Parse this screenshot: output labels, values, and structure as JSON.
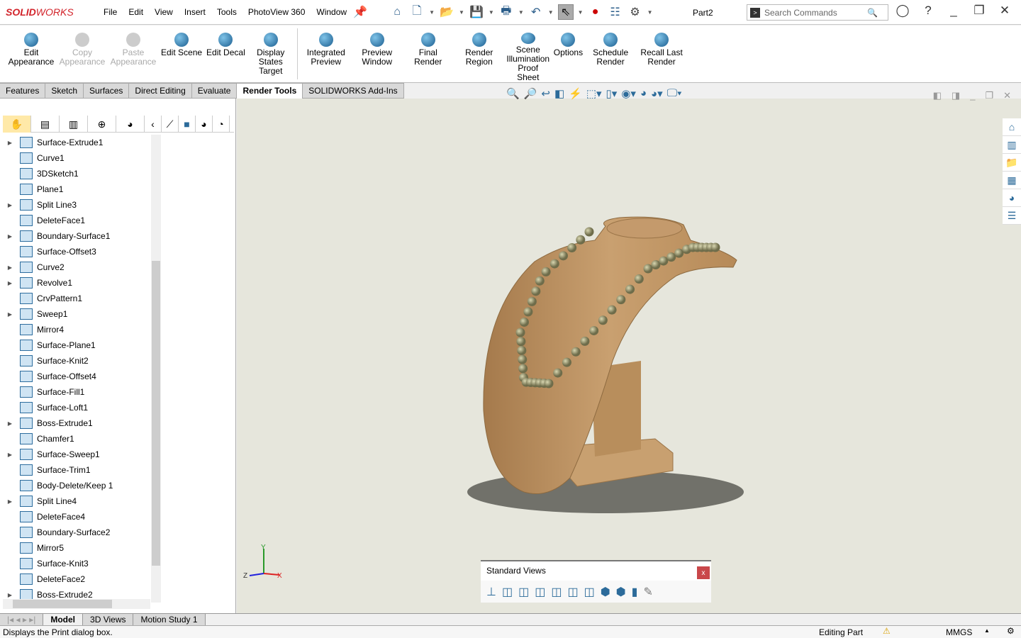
{
  "app": {
    "brand_bold": "SOLID",
    "brand_light": "WORKS",
    "document_title": "Part2"
  },
  "menu": [
    "File",
    "Edit",
    "View",
    "Insert",
    "Tools",
    "PhotoView 360",
    "Window"
  ],
  "search": {
    "placeholder": "Search Commands"
  },
  "ribbon": [
    {
      "label": "Edit Appearance",
      "enabled": true
    },
    {
      "label": "Copy Appearance",
      "enabled": false
    },
    {
      "label": "Paste Appearance",
      "enabled": false
    },
    {
      "label": "Edit Scene",
      "enabled": true
    },
    {
      "label": "Edit Decal",
      "enabled": true
    },
    {
      "label": "Display States Target",
      "enabled": true
    },
    {
      "label": "Integrated Preview",
      "enabled": true
    },
    {
      "label": "Preview Window",
      "enabled": true
    },
    {
      "label": "Final Render",
      "enabled": true
    },
    {
      "label": "Render Region",
      "enabled": true
    },
    {
      "label": "Scene Illumination Proof Sheet",
      "enabled": true
    },
    {
      "label": "Options",
      "enabled": true
    },
    {
      "label": "Schedule Render",
      "enabled": true
    },
    {
      "label": "Recall Last Render",
      "enabled": true
    }
  ],
  "command_tabs": [
    {
      "label": "Features"
    },
    {
      "label": "Sketch"
    },
    {
      "label": "Surfaces"
    },
    {
      "label": "Direct Editing"
    },
    {
      "label": "Evaluate"
    },
    {
      "label": "Render Tools",
      "active": true
    },
    {
      "label": "SOLIDWORKS Add-Ins"
    }
  ],
  "feature_tree": [
    {
      "label": "Surface-Extrude1",
      "expandable": true
    },
    {
      "label": "Curve1"
    },
    {
      "label": "3DSketch1"
    },
    {
      "label": "Plane1"
    },
    {
      "label": "Split Line3",
      "expandable": true
    },
    {
      "label": "DeleteFace1"
    },
    {
      "label": "Boundary-Surface1",
      "expandable": true
    },
    {
      "label": "Surface-Offset3"
    },
    {
      "label": "Curve2",
      "expandable": true
    },
    {
      "label": "Revolve1",
      "expandable": true
    },
    {
      "label": "CrvPattern1"
    },
    {
      "label": "Sweep1",
      "expandable": true
    },
    {
      "label": "Mirror4"
    },
    {
      "label": "Surface-Plane1"
    },
    {
      "label": "Surface-Knit2"
    },
    {
      "label": "Surface-Offset4"
    },
    {
      "label": "Surface-Fill1"
    },
    {
      "label": "Surface-Loft1"
    },
    {
      "label": "Boss-Extrude1",
      "expandable": true
    },
    {
      "label": "Chamfer1"
    },
    {
      "label": "Surface-Sweep1",
      "expandable": true
    },
    {
      "label": "Surface-Trim1"
    },
    {
      "label": "Body-Delete/Keep 1"
    },
    {
      "label": "Split Line4",
      "expandable": true
    },
    {
      "label": "DeleteFace4"
    },
    {
      "label": "Boundary-Surface2"
    },
    {
      "label": "Mirror5"
    },
    {
      "label": "Surface-Knit3"
    },
    {
      "label": "DeleteFace2"
    },
    {
      "label": "Boss-Extrude2",
      "expandable": true
    }
  ],
  "standard_views": {
    "title": "Standard Views",
    "close": "x"
  },
  "triad": {
    "x": "X",
    "y": "Y",
    "z": "Z"
  },
  "bottom_tabs": [
    {
      "label": "Model",
      "active": true
    },
    {
      "label": "3D Views"
    },
    {
      "label": "Motion Study 1"
    }
  ],
  "status": {
    "message": "Displays the Print dialog box.",
    "mode": "Editing Part",
    "units": "MMGS"
  },
  "colors": {
    "brand": "#d2232a",
    "wood": "#c49a6c",
    "viewport_bg": "#e6e6dc",
    "close_red": "#c9474a"
  }
}
